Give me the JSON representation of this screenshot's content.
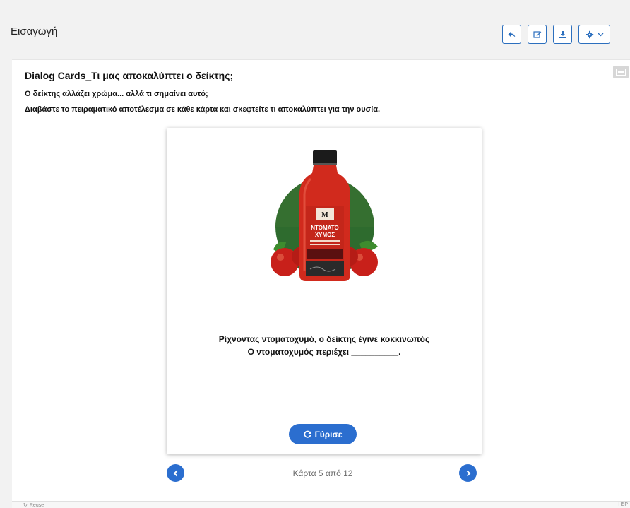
{
  "header": {
    "title": "Εισαγωγή",
    "buttons": [
      {
        "name": "undo-button",
        "icon": "reply-icon"
      },
      {
        "name": "edit-button",
        "icon": "edit-icon"
      },
      {
        "name": "download-button",
        "icon": "download-icon"
      },
      {
        "name": "settings-button",
        "icon": "gear-icon"
      }
    ]
  },
  "activity": {
    "title": "Dialog Cards_Τι μας αποκαλύπτει ο δείκτης;",
    "description_line1": "Ο δείκτης αλλάζει χρώμα... αλλά τι σημαίνει αυτό;",
    "description_line2": "Διαβάστε το πειραματικό αποτέλεσμα σε κάθε κάρτα και σκεφτείτε τι αποκαλύπτει για την ουσία."
  },
  "card": {
    "image_alt": "tomato-juice-bottle-image",
    "bottle_label_line1": "ΝΤΟΜΑΤΟ",
    "bottle_label_line2": "ΧΥΜΟΣ",
    "text_line1": "Ρίχνοντας ντοματοχυμό, ο δείκτης έγινε κοκκινωπός",
    "text_line2": "Ο ντοματοχυμός περιέχει __________.",
    "turn_label": "Γύρισε"
  },
  "navigation": {
    "progress": "Κάρτα 5 από 12"
  },
  "footer": {
    "reuse_label": "Reuse",
    "h5p_label": "H5P"
  },
  "colors": {
    "accent": "#2b6ecf",
    "toolbar_border": "#2c6fbe",
    "background": "#f2f2f2",
    "tomato_red": "#d0261c",
    "circle_green": "#2e6b2e"
  }
}
